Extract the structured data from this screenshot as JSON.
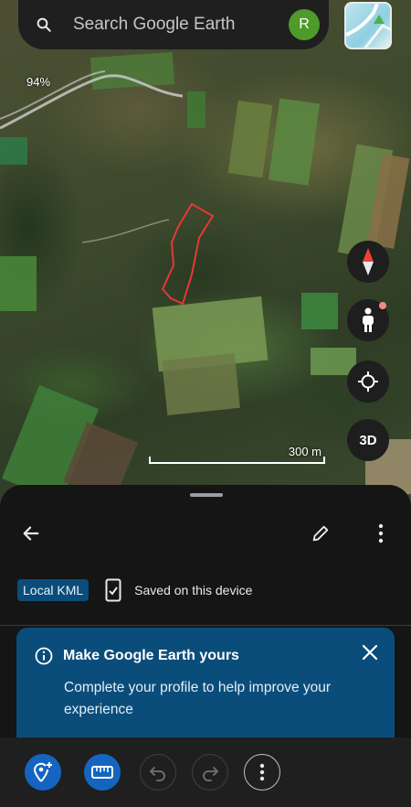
{
  "search": {
    "placeholder": "Search Google Earth"
  },
  "account": {
    "avatar_initial": "R",
    "avatar_color": "#4e9a2a"
  },
  "map": {
    "zoom_label": "94%",
    "scale_label": "300 m",
    "controls": {
      "compass": "compass-icon",
      "street_view": "pegman-icon",
      "my_location": "my-location-icon",
      "view_3d": "3D"
    },
    "polygon_color": "#e53935"
  },
  "sheet": {
    "source_chip": "Local KML",
    "saved_status": "Saved on this device"
  },
  "promo": {
    "title": "Make Google Earth yours",
    "body": "Complete your profile to help improve your experience"
  },
  "bottom_bar": {
    "buttons": [
      "add-placemark-icon",
      "measure-icon",
      "undo-icon",
      "redo-icon",
      "more-icon"
    ]
  },
  "colors": {
    "accent_blue": "#1565c0",
    "promo_blue": "#0b4d7a",
    "sheet_bg": "#151515"
  }
}
